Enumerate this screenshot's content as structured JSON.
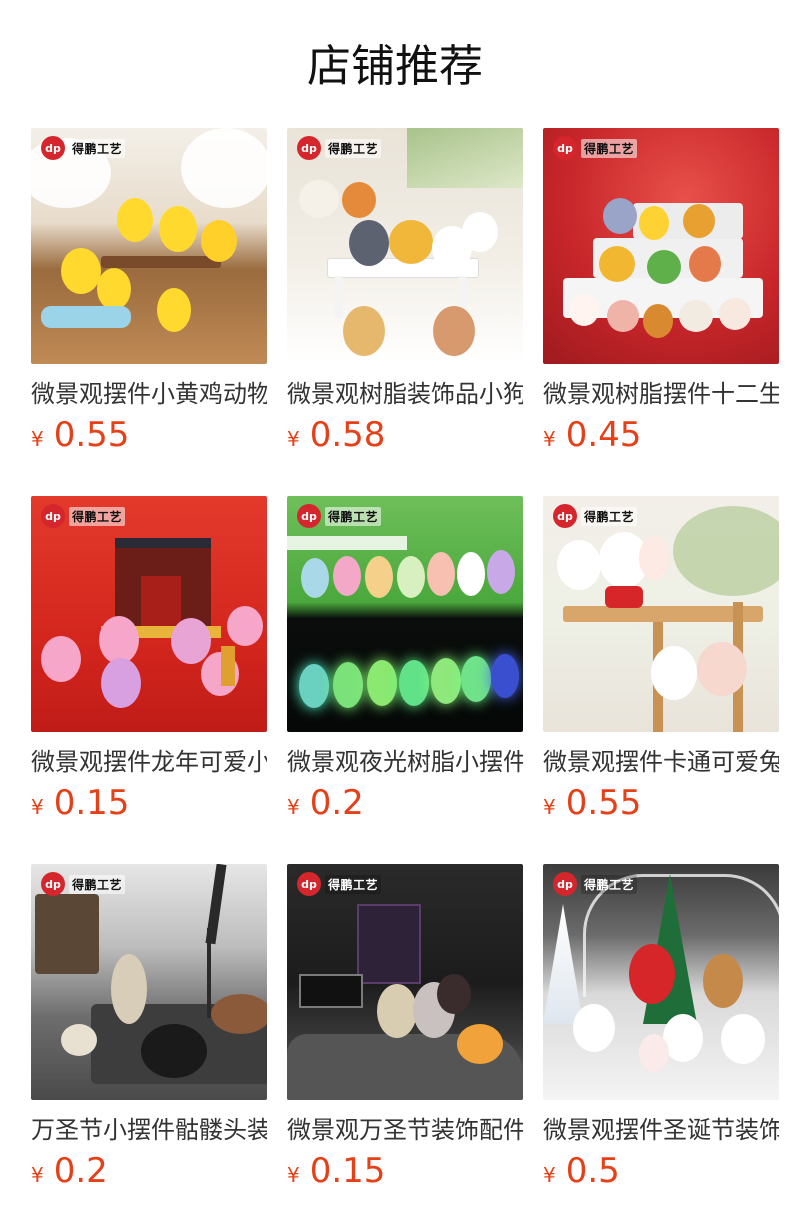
{
  "header": {
    "title": "店铺推荐"
  },
  "brand": {
    "badge_text": "dp",
    "name": "得鹏工艺"
  },
  "products": [
    {
      "title": "微景观摆件小黄鸡动物",
      "currency": "¥",
      "price": "0.55",
      "scene": "chicks"
    },
    {
      "title": "微景观树脂装饰品小狗",
      "currency": "¥",
      "price": "0.58",
      "scene": "dogs"
    },
    {
      "title": "微景观树脂摆件十二生肖",
      "currency": "¥",
      "price": "0.45",
      "scene": "zodiac"
    },
    {
      "title": "微景观摆件龙年可爱小龙",
      "currency": "¥",
      "price": "0.15",
      "scene": "dragons"
    },
    {
      "title": "微景观夜光树脂小摆件兔",
      "currency": "¥",
      "price": "0.2",
      "scene": "glowbunnies"
    },
    {
      "title": "微景观摆件卡通可爱兔子",
      "currency": "¥",
      "price": "0.55",
      "scene": "bunnies"
    },
    {
      "title": "万圣节小摆件骷髅头装饰",
      "currency": "¥",
      "price": "0.2",
      "scene": "halloween1"
    },
    {
      "title": "微景观万圣节装饰配件",
      "currency": "¥",
      "price": "0.15",
      "scene": "halloween2"
    },
    {
      "title": "微景观摆件圣诞节装饰品",
      "currency": "¥",
      "price": "0.5",
      "scene": "christmas"
    }
  ]
}
